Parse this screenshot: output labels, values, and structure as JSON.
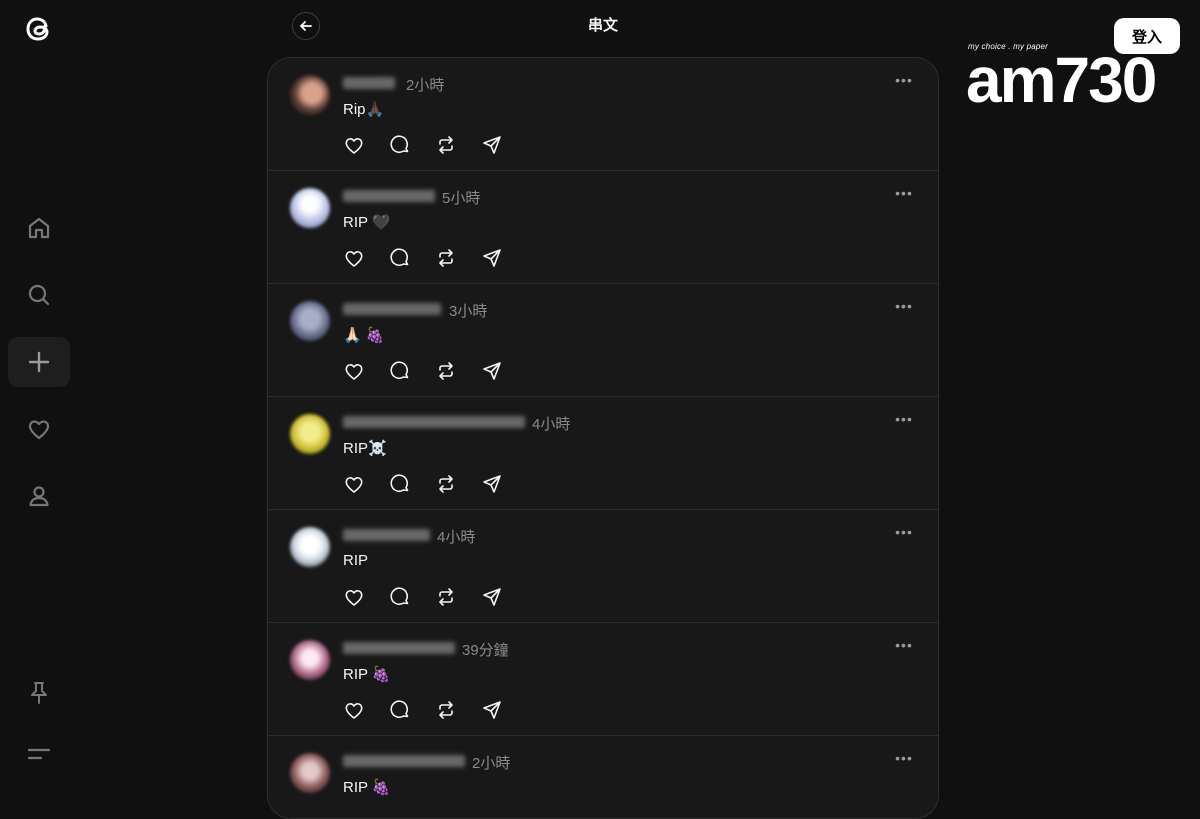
{
  "header": {
    "title": "串文",
    "login_label": "登入"
  },
  "watermark": {
    "tagline": "my choice . my paper",
    "logo": "am730"
  },
  "sidebar": {
    "items": [
      {
        "icon": "home-icon"
      },
      {
        "icon": "search-icon"
      },
      {
        "icon": "plus-icon"
      },
      {
        "icon": "heart-icon"
      },
      {
        "icon": "profile-icon"
      }
    ],
    "bottom": [
      {
        "icon": "pin-icon"
      },
      {
        "icon": "menu-icon"
      }
    ]
  },
  "posts": [
    {
      "time": "2小時",
      "content": "Rip🙏🏿"
    },
    {
      "time": "5小時",
      "content": "RIP 🖤"
    },
    {
      "time": "3小時",
      "content": "🙏🏻 🍇"
    },
    {
      "time": "4小時",
      "content": "RIP☠️"
    },
    {
      "time": "4小時",
      "content": "RIP"
    },
    {
      "time": "39分鐘",
      "content": "RIP 🍇"
    },
    {
      "time": "2小時",
      "content": "RIP 🍇"
    }
  ],
  "colors": {
    "background": "#101010",
    "panel": "#181818",
    "border": "#2d2d2d",
    "muted": "#8a8a8a"
  }
}
